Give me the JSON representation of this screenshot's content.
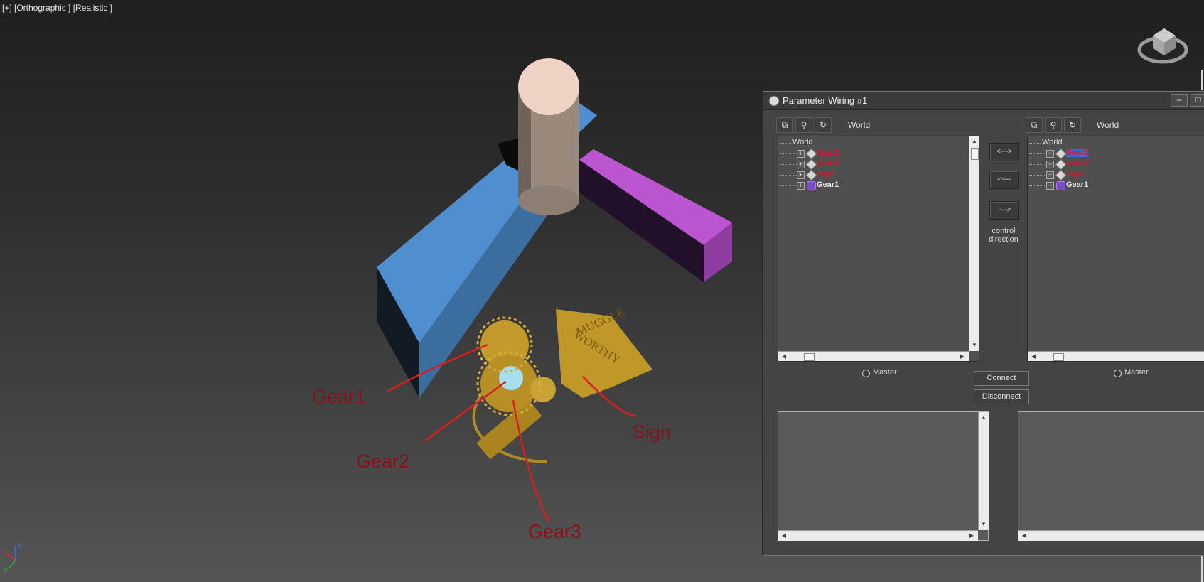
{
  "viewport": {
    "label": "[+] [Orthographic ] [Realistic ]",
    "annotations": [
      {
        "name": "gear1-label",
        "text": "Gear1"
      },
      {
        "name": "gear2-label",
        "text": "Gear2"
      },
      {
        "name": "gear3-label",
        "text": "Gear3"
      },
      {
        "name": "sign-label",
        "text": "Sign"
      }
    ],
    "sign_text": [
      "MUGGLE",
      "WORTHY"
    ],
    "axis": {
      "x": "x",
      "y": "y",
      "z": "z"
    },
    "colors": {
      "annotation": "#8c0f1c",
      "gold": "#b8901f",
      "blue_box": "#4f8fd0",
      "magenta_box": "#bb55d0",
      "cylinder_top": "#efd3c4"
    }
  },
  "dialog": {
    "title": "Parameter Wiring #1",
    "title_buttons": [
      "‒",
      "□"
    ],
    "left": {
      "root_label": "World",
      "header_label": "World",
      "tree": [
        {
          "name": "Gear2",
          "color": "red"
        },
        {
          "name": "Gear3",
          "color": "red"
        },
        {
          "name": "Sign",
          "color": "red"
        },
        {
          "name": "Gear1",
          "color": "white"
        }
      ],
      "master_label": "Master"
    },
    "right": {
      "root_label": "World",
      "header_label": "World",
      "tree": [
        {
          "name": "Gear2",
          "color": "red",
          "selected": true
        },
        {
          "name": "Gear3",
          "color": "red"
        },
        {
          "name": "Sign",
          "color": "red"
        },
        {
          "name": "Gear1",
          "color": "white"
        }
      ],
      "master_label": "Master"
    },
    "direction_buttons": [
      "<--->",
      "<----",
      "---->"
    ],
    "control_direction_label": "control direction",
    "connect_label": "Connect",
    "disconnect_label": "Disconnect"
  }
}
